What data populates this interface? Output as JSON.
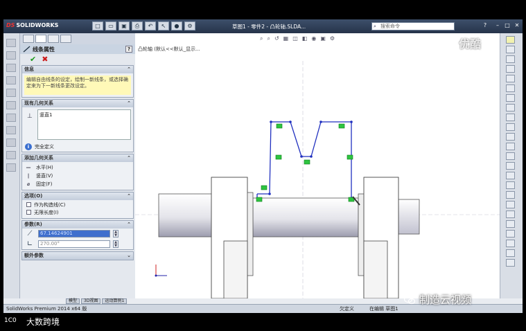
{
  "app": {
    "logo_ds": "DS",
    "logo_name": "SOLIDWORKS",
    "document_title": "草图1 - 零件2 - 凸轮轴.SLDA...",
    "search_placeholder": "搜索命令",
    "quick_access_icons": [
      "new-icon",
      "open-icon",
      "save-icon",
      "print-icon",
      "undo-icon",
      "select-icon",
      "rebuild-icon",
      "options-icon"
    ]
  },
  "property_manager": {
    "title": "线条属性",
    "help": "?",
    "ok": "✔",
    "cancel": "✖",
    "info_group": {
      "label": "信息",
      "message": "编辑自由线条的设定，绘制一新线条，或选择确定来为下一新线条更改设定。"
    },
    "existing_relations_group": {
      "label": "现有几何关系",
      "items": [
        "竖直1"
      ],
      "status": "完全定义"
    },
    "add_relations_group": {
      "label": "添加几何关系",
      "items": [
        {
          "symbol": "—",
          "label": "水平(H)"
        },
        {
          "symbol": "|",
          "label": "竖直(V)"
        },
        {
          "symbol": "⌀",
          "label": "固定(F)"
        }
      ]
    },
    "options_group": {
      "label": "选项(O)",
      "items": [
        "作为构造线(C)",
        "无限长度(I)"
      ]
    },
    "parameters_group": {
      "label": "参数(R)",
      "length_value": "67.14624901",
      "angle_value": "270.00°"
    },
    "extra_group": {
      "label": "额外参数"
    }
  },
  "canvas": {
    "breadcrumb": "凸轮轴 (默认<<默认_显示..."
  },
  "tabs": [
    "模型",
    "3D视图",
    "运动算例1"
  ],
  "statusbar": {
    "product": "SolidWorks Premium 2014 x64 版",
    "state": "欠定义",
    "mode": "在编辑 草图1"
  },
  "watermarks": {
    "youku": "优酷",
    "wechat": "制造云视频",
    "bottom_brand": "大数跨境",
    "bottom_logo": "1C0"
  }
}
